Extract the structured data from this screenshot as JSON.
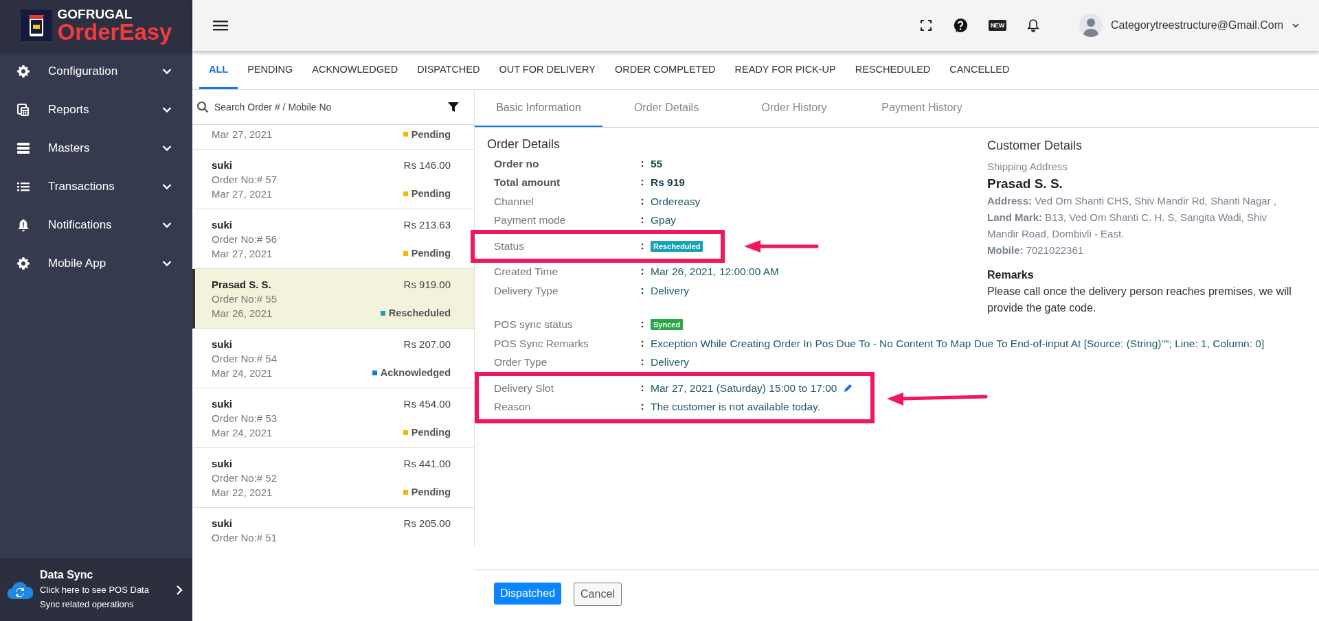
{
  "brand": {
    "top": "GOFRUGAL",
    "name": "OrderEasy"
  },
  "sidebar": {
    "items": [
      {
        "label": "Configuration",
        "kind": "gear"
      },
      {
        "label": "Reports",
        "kind": "calculator"
      },
      {
        "label": "Masters",
        "kind": "server"
      },
      {
        "label": "Transactions",
        "kind": "list"
      },
      {
        "label": "Notifications",
        "kind": "bell"
      },
      {
        "label": "Mobile App",
        "kind": "gear"
      }
    ],
    "data_sync": {
      "title": "Data Sync",
      "text": "Click here to see POS Data Sync related operations"
    }
  },
  "topbar": {
    "new_badge": "NEW",
    "user": "Categorytreestructure@Gmail.Com"
  },
  "status_tabs": [
    {
      "label": "ALL",
      "selected": true
    },
    {
      "label": "PENDING",
      "selected": false
    },
    {
      "label": "ACKNOWLEDGED",
      "selected": false
    },
    {
      "label": "DISPATCHED",
      "selected": false
    },
    {
      "label": "OUT FOR DELIVERY",
      "selected": false
    },
    {
      "label": "ORDER COMPLETED",
      "selected": false
    },
    {
      "label": "READY FOR PICK-UP",
      "selected": false
    },
    {
      "label": "RESCHEDULED",
      "selected": false
    },
    {
      "label": "CANCELLED",
      "selected": false
    }
  ],
  "search": {
    "placeholder": "Search Order # / Mobile No"
  },
  "orders": [
    {
      "date": "Mar 27, 2021",
      "status": "Pending",
      "color": "#f5b800",
      "selected": false
    },
    {
      "name": "suki",
      "amount": "Rs 146.00",
      "order_no": "Order No:# 57",
      "date": "Mar 27, 2021",
      "status": "Pending",
      "color": "#f5b800",
      "selected": false
    },
    {
      "name": "suki",
      "amount": "Rs 213.63",
      "order_no": "Order No:# 56",
      "date": "Mar 27, 2021",
      "status": "Pending",
      "color": "#f5b800",
      "selected": false
    },
    {
      "name": "Prasad S. S.",
      "amount": "Rs 919.00",
      "order_no": "Order No:# 55",
      "date": "Mar 26, 2021",
      "status": "Rescheduled",
      "color": "#17a2b8",
      "selected": true
    },
    {
      "name": "suki",
      "amount": "Rs 207.00",
      "order_no": "Order No:# 54",
      "date": "Mar 24, 2021",
      "status": "Acknowledged",
      "color": "#1a73e8",
      "selected": false
    },
    {
      "name": "suki",
      "amount": "Rs 454.00",
      "order_no": "Order No:# 53",
      "date": "Mar 24, 2021",
      "status": "Pending",
      "color": "#f5b800",
      "selected": false
    },
    {
      "name": "suki",
      "amount": "Rs 441.00",
      "order_no": "Order No:# 52",
      "date": "Mar 22, 2021",
      "status": "Pending",
      "color": "#f5b800",
      "selected": false
    },
    {
      "name": "suki",
      "amount": "Rs 205.00",
      "order_no": "Order No:# 51",
      "selected": false
    }
  ],
  "detail_tabs": [
    {
      "label": "Basic Information",
      "selected": true
    },
    {
      "label": "Order Details",
      "selected": false
    },
    {
      "label": "Order History",
      "selected": false
    },
    {
      "label": "Payment History",
      "selected": false
    }
  ],
  "order_details": {
    "title": "Order Details",
    "sections": [
      {
        "groups": [
          {
            "highlighted": false,
            "fields": [
              {
                "label": "Order no",
                "value": "55",
                "kind": "bold"
              },
              {
                "label": "Total amount",
                "value": "Rs 919",
                "kind": "bold"
              },
              {
                "label": "Channel",
                "value": "Ordereasy",
                "kind": "text"
              },
              {
                "label": "Payment mode",
                "value": "Gpay",
                "kind": "text"
              }
            ]
          },
          {
            "highlighted": true,
            "fields": [
              {
                "label": "Status",
                "value": "Rescheduled",
                "kind": "badge",
                "color": "#17a2b8"
              }
            ]
          },
          {
            "highlighted": false,
            "fields": [
              {
                "label": "Created Time",
                "value": "Mar 26, 2021, 12:00:00 AM",
                "kind": "text"
              },
              {
                "label": "Delivery Type",
                "value": "Delivery",
                "kind": "text"
              }
            ]
          }
        ]
      },
      {
        "groups": [
          {
            "highlighted": false,
            "fields": [
              {
                "label": "POS sync status",
                "value": "Synced",
                "kind": "badge",
                "color": "#28a745"
              },
              {
                "label": "POS Sync Remarks",
                "value": "Exception While Creating Order In Pos Due To - No Content To Map Due To End-of-input At [Source: (String)\"\"; Line: 1, Column: 0]",
                "kind": "text"
              },
              {
                "label": "Order Type",
                "value": "Delivery",
                "kind": "text"
              }
            ]
          },
          {
            "highlighted": true,
            "fields": [
              {
                "label": "Delivery Slot",
                "value": "Mar 27, 2021  (Saturday) 15:00 to 17:00",
                "kind": "editable"
              },
              {
                "label": "Reason",
                "value": "The customer is not available today.",
                "kind": "text"
              }
            ]
          }
        ]
      }
    ]
  },
  "customer": {
    "title": "Customer Details",
    "subtitle": "Shipping Address",
    "name": "Prasad S. S.",
    "lines": [
      "**Address:** Ved Om Shanti CHS, Shiv Mandir Rd, Shanti Nagar ,",
      "**Land Mark:** B13, Ved Om Shanti C. H. S, Sangita Wadi, Shiv Mandir Road, Dombivli - East.",
      "**Mobile:** 7021022361"
    ],
    "remarks_title": "Remarks",
    "remarks": "Please call once the delivery person reaches premises, we will provide the gate code."
  },
  "actions": [
    {
      "label": "Dispatched",
      "kind": "primary"
    },
    {
      "label": "Cancel",
      "kind": "secondary"
    }
  ]
}
